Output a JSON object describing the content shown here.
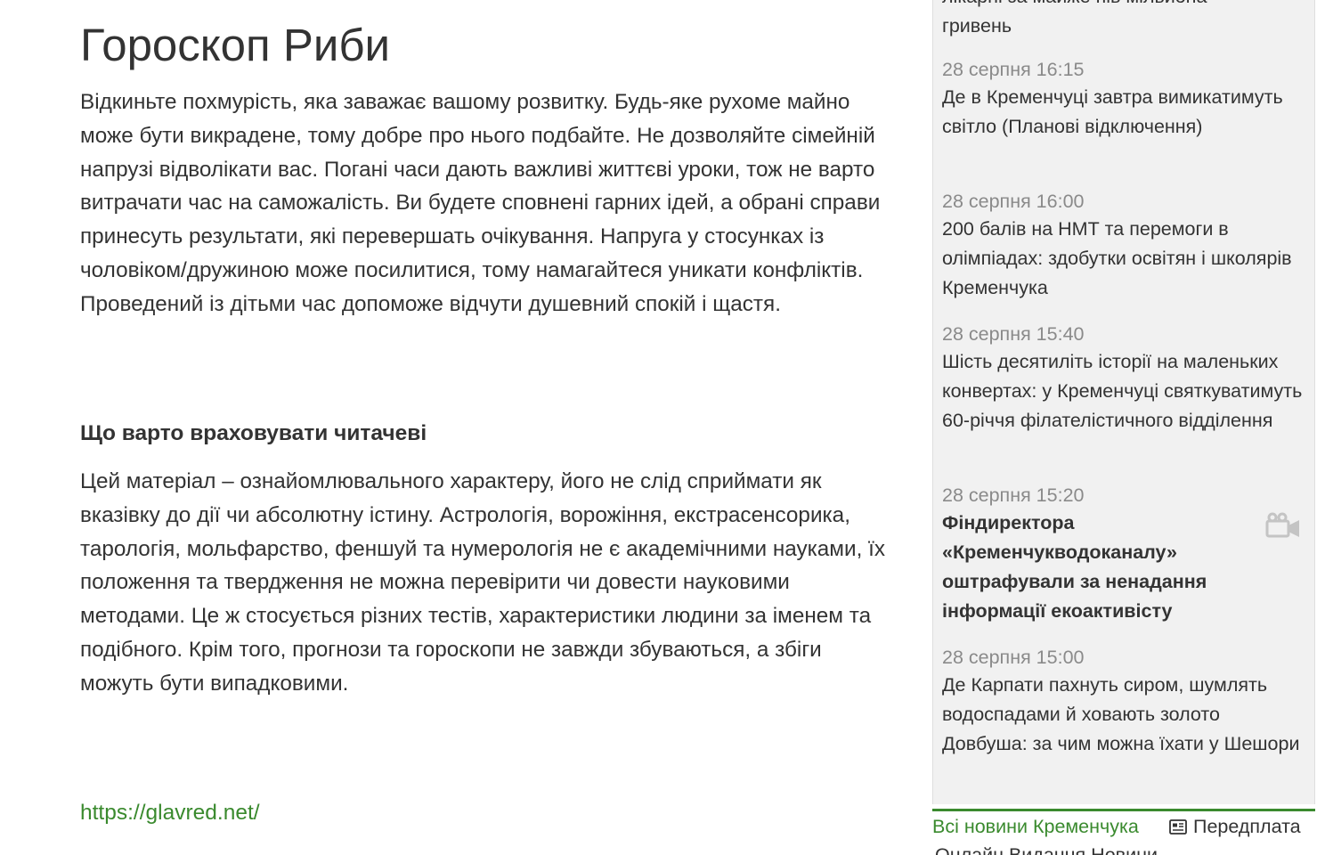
{
  "article": {
    "title": "Гороскоп Риби",
    "paragraph_1": "Відкиньте похмурість, яка заважає вашому розвитку. Будь-яке рухоме майно може бути викрадене, тому добре про нього подбайте. Не дозволяйте сімейній напрузі відволікати вас. Погані часи дають важливі життєві уроки, тож не варто витрачати час на саможалість. Ви будете сповнені гарних ідей, а обрані справи принесуть результати, які перевершать очікування. Напруга у стосунках із чоловіком/дружиною може посилитися, тому намагайтеся уникати конфліктів. Проведений із дітьми час допоможе відчути душевний спокій і щастя.",
    "section_heading": "Що варто враховувати читачеві",
    "paragraph_2": "Цей матеріал – ознайомлювального характеру, його не слід сприймати як вказівку до дії чи абсолютну істину. Астрологія, ворожіння, екстрасенсорика, тарологія, мольфарство, феншуй та нумерологія не є академічними науками, їх положення та твердження не можна перевірити чи довести науковими методами. Це ж стосується різних тестів, характеристики людини за іменем та подібного. Крім того, прогнози та гороскопи не завжди збуваються, а збіги можуть бути випадковими.",
    "source_link": "https://glavred.net/"
  },
  "sidebar": {
    "cut_top_title": "лікарні за майже пів мільйона\nгривень",
    "news": [
      {
        "date": "28 серпня 16:15",
        "title": "Де в Кременчуці завтра вимикатимуть світло (Планові відключення)",
        "bold": false,
        "video": false
      },
      {
        "date": "28 серпня 16:00",
        "title": "200 балів на НМТ та перемоги в олімпіадах: здобутки освітян і школярів Кременчука",
        "bold": false,
        "video": false
      },
      {
        "date": "28 серпня 15:40",
        "title": "Шість десятиліть історії на маленьких конвертах: у Кременчуці святкуватимуть 60-річчя філателістичного відділення",
        "bold": false,
        "video": false
      },
      {
        "date": "28 серпня 15:20",
        "title": "Фіндиректора «Кременчукводоканалу» оштрафували за ненадання інформації екоактивісту",
        "bold": true,
        "video": true
      },
      {
        "date": "28 серпня 15:00",
        "title": "Де Карпати пахнуть сиром, шумлять водоспадами й ховають золото Довбуша: за чим можна їхати у Шешори",
        "bold": false,
        "video": false
      }
    ],
    "all_news_label": "Всі новини Кременчука",
    "subscribe_label": "Передплата",
    "cut_bottom_text": "Онлайн Видання Новини"
  },
  "colors": {
    "accent_green": "#3a8a2e",
    "date_gray": "#8a8a8a",
    "sidebar_bg": "#f1f1f1",
    "text": "#333333"
  },
  "icons": {
    "video": "video-camera-icon",
    "subscribe": "newspaper-icon"
  }
}
